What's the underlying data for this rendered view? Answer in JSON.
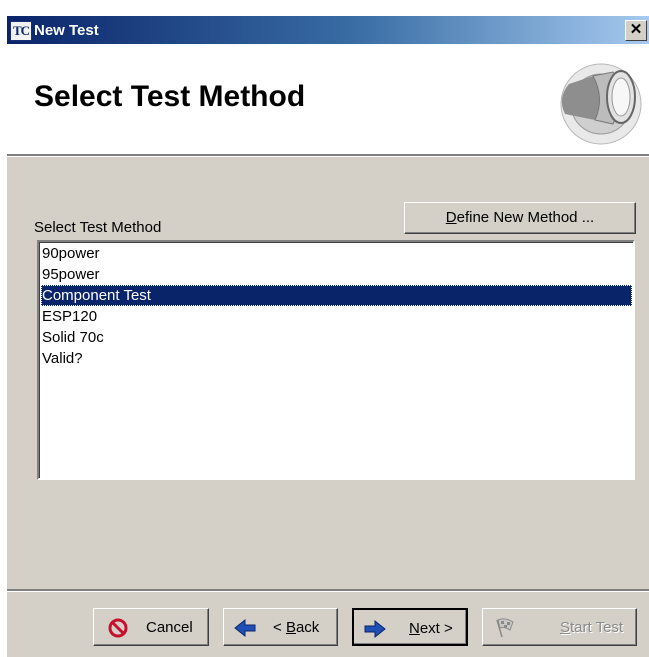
{
  "window": {
    "app_icon_text": "TC",
    "title": "New Test",
    "close_glyph": "✕"
  },
  "header": {
    "title": "Select Test Method",
    "art_icon": "speaker-icon"
  },
  "main": {
    "list_label": "Select Test Method",
    "define_button": {
      "mnemonic": "D",
      "rest": "efine New Method ..."
    },
    "methods": [
      {
        "label": "90power",
        "selected": false
      },
      {
        "label": "95power",
        "selected": false
      },
      {
        "label": "Component Test",
        "selected": true
      },
      {
        "label": "ESP120",
        "selected": false
      },
      {
        "label": "Solid 70c",
        "selected": false
      },
      {
        "label": "Valid?",
        "selected": false
      }
    ]
  },
  "footer": {
    "cancel": {
      "label": "Cancel",
      "icon": "cancel-icon",
      "enabled": true
    },
    "back": {
      "prefix": "< ",
      "mnemonic": "B",
      "rest": "ack",
      "icon": "back-arrow-icon",
      "enabled": true
    },
    "next": {
      "mnemonic": "N",
      "rest": "ext >",
      "icon": "next-arrow-icon",
      "enabled": true
    },
    "start": {
      "mnemonic": "S",
      "rest": "tart Test",
      "icon": "checkered-flag-icon",
      "enabled": false
    }
  },
  "colors": {
    "title_bar_start": "#0a246a",
    "title_bar_end": "#a6caf0",
    "selection": "#0a246a",
    "dialog_face": "#d4d0c8"
  }
}
